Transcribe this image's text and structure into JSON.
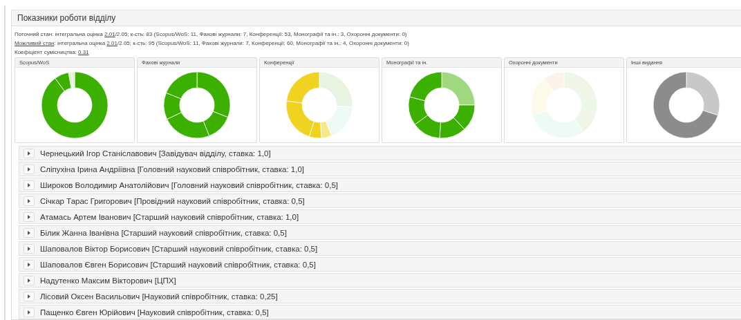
{
  "panel": {
    "title": "Показники роботи відділу"
  },
  "summary": [
    {
      "label": "Поточний стан",
      "label_link": false,
      "prefix": ": інтегральна оцінка ",
      "score": "2.01",
      "rest": "/2.05; к-сть: 83 (Scopus/WoS: 11, Фахові журнали: 7, Конференції: 53, Монографії та ін.: 3, Охоронні документи: 0)"
    },
    {
      "label": "Можливий стан",
      "label_link": true,
      "prefix": ": інтегральна оцінка ",
      "score": "2.01",
      "rest": "/2.05; к-сть: 95 (Scopus/WoS: 11, Фахові журнали: 7, Конференції: 60, Монографії та ін.: 4, Охоронні документи: 0)"
    },
    {
      "label": "Коефіцієнт сумісництва",
      "label_link": false,
      "prefix": ": ",
      "score": "0.31"
    }
  ],
  "charts": [
    {
      "title": "Scopus/WoS"
    },
    {
      "title": "Фахові журнали"
    },
    {
      "title": "Конференції"
    },
    {
      "title": "Монографії та ін."
    },
    {
      "title": "Охоронні документи"
    },
    {
      "title": "Інші видання"
    }
  ],
  "staff": [
    {
      "text": "Чернецький Ігор Станіславович [Завідувач відділу, ставка: 1,0]"
    },
    {
      "text": "Сліпухіна Ірина Андріївна [Головний науковий співробітник, ставка: 1,0]"
    },
    {
      "text": "Широков Володимир Анатолійович [Головний науковий співробітник, ставка: 0,5]"
    },
    {
      "text": "Січкар Тарас Григорович [Провідний науковий співробітник, ставка: 0,5]"
    },
    {
      "text": "Атамась Артем Іванович [Старший науковий співробітник, ставка: 1,0]"
    },
    {
      "text": "Білик Жанна Іванівна [Старший науковий співробітник, ставка: 0,5]"
    },
    {
      "text": "Шаповалов Віктор Борисович [Старший науковий співробітник, ставка: 0,5]"
    },
    {
      "text": "Шаповалов Євген Борисович [Старший науковий співробітник, ставка: 0,5]"
    },
    {
      "text": "Надутенко Максим Вікторович [ЦПХ]"
    },
    {
      "text": "Лісовий Оксен Васильович [Науковий співробітник, ставка: 0,25]"
    },
    {
      "text": "Пащенко Євген Юрійович [Науковий співробітник, ставка: 0,5]"
    }
  ]
}
